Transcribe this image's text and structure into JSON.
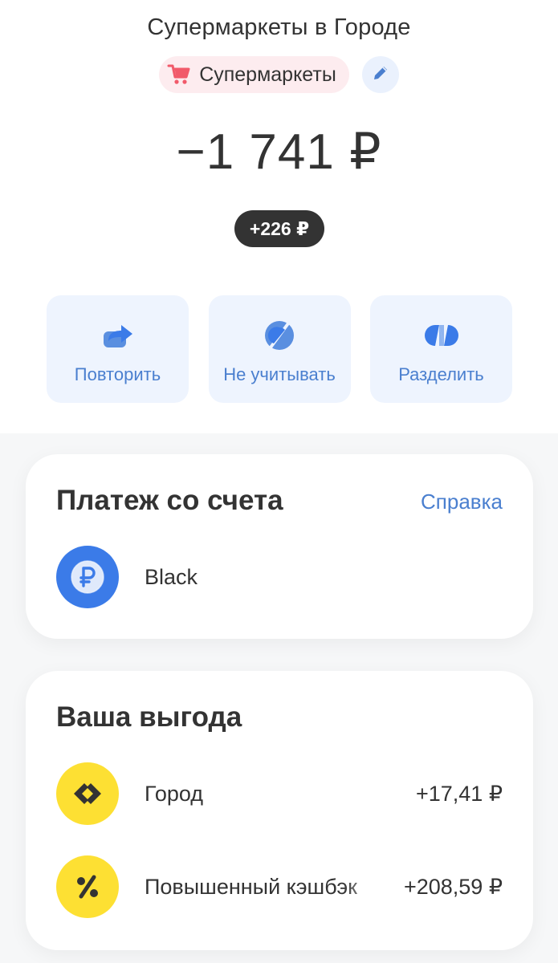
{
  "merchant": "Супермаркеты в Городе",
  "category": {
    "label": "Супермаркеты",
    "icon": "cart-icon",
    "color": "#f15a6a"
  },
  "amount": "−1 741 ₽",
  "cashback_total": "+226 ₽",
  "actions": [
    {
      "label": "Повторить",
      "icon": "repeat-icon"
    },
    {
      "label": "Не учитывать",
      "icon": "exclude-icon"
    },
    {
      "label": "Разделить",
      "icon": "split-icon"
    }
  ],
  "payment": {
    "title": "Платеж со счета",
    "help": "Справка",
    "account": {
      "name": "Black",
      "icon": "ruble-icon"
    }
  },
  "benefit": {
    "title": "Ваша выгода",
    "items": [
      {
        "name": "Город",
        "value": "+17,41 ₽",
        "icon": "gorod-icon"
      },
      {
        "name": "Повышенный кэшбэк",
        "value": "+208,59 ₽",
        "icon": "percent-icon"
      }
    ]
  },
  "colors": {
    "accent": "#4a7fcf",
    "yellow": "#fde033",
    "dark": "#333333"
  }
}
